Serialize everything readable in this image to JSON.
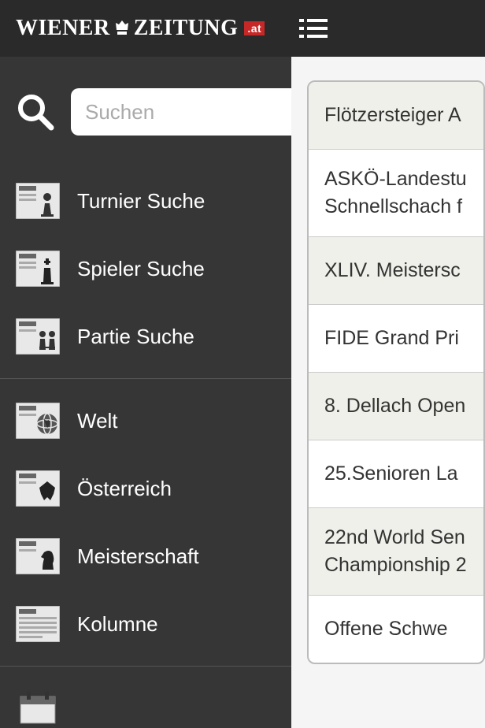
{
  "header": {
    "logo_part1": "WIENER",
    "logo_part2": "ZEITUNG",
    "badge": ".at"
  },
  "sidebar": {
    "search_placeholder": "Suchen",
    "group1": [
      {
        "label": "Turnier Suche",
        "icon": "chess-pawn-news"
      },
      {
        "label": "Spieler Suche",
        "icon": "chess-king-news"
      },
      {
        "label": "Partie Suche",
        "icon": "chess-players-news"
      }
    ],
    "group2": [
      {
        "label": "Welt",
        "icon": "globe-news"
      },
      {
        "label": "Österreich",
        "icon": "eagle-news"
      },
      {
        "label": "Meisterschaft",
        "icon": "chess-knight-news"
      },
      {
        "label": "Kolumne",
        "icon": "newspaper"
      }
    ]
  },
  "main": {
    "items": [
      {
        "text": "Flötzersteiger A",
        "alt": true,
        "tall": false
      },
      {
        "text": "ASKÖ-Landestu Schnellschach f",
        "alt": false,
        "tall": true
      },
      {
        "text": "XLIV. Meistersc",
        "alt": true,
        "tall": false
      },
      {
        "text": "FIDE Grand Pri",
        "alt": false,
        "tall": false
      },
      {
        "text": "8. Dellach Open",
        "alt": true,
        "tall": false
      },
      {
        "text": "25.Senioren La",
        "alt": false,
        "tall": false
      },
      {
        "text": "22nd World Sen Championship 2",
        "alt": true,
        "tall": true
      },
      {
        "text": "Offene Schwe",
        "alt": false,
        "tall": false
      }
    ]
  }
}
